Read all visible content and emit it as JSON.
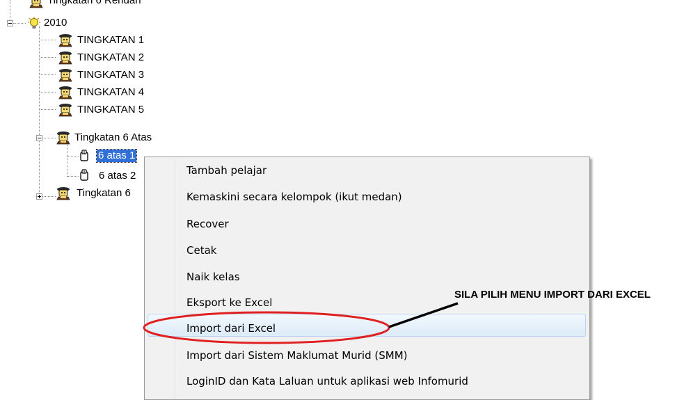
{
  "tree": {
    "top_partial_label": "Tingkatan 6 Rendah",
    "year_node": "2010",
    "items": [
      {
        "label": "TINGKATAN 1"
      },
      {
        "label": "TINGKATAN 2"
      },
      {
        "label": "TINGKATAN 3"
      },
      {
        "label": "TINGKATAN 4"
      },
      {
        "label": "TINGKATAN 5"
      },
      {
        "label": "Tingkatan 6 Atas"
      }
    ],
    "class_items": [
      {
        "label": "6 atas 1",
        "selected": true
      },
      {
        "label": "6 atas 2"
      }
    ],
    "bottom_node": "Tingkatan 6"
  },
  "context_menu": {
    "items": [
      {
        "label": "Tambah pelajar"
      },
      {
        "label": "Kemaskini secara kelompok (ikut medan)"
      },
      {
        "label": "Recover"
      },
      {
        "label": "Cetak"
      },
      {
        "label": "Naik kelas"
      },
      {
        "label": "Eksport ke Excel"
      },
      {
        "label": "Import dari Excel",
        "highlighted": true
      },
      {
        "label": "Import dari Sistem Maklumat Murid (SMM)"
      },
      {
        "label": "LoginID dan Kata Laluan untuk aplikasi web Infomurid"
      }
    ]
  },
  "annotation": {
    "text": "SILA PILIH MENU IMPORT DARI EXCEL",
    "ellipse_color": "#e02020"
  },
  "icons": {
    "year": "lightbulb-icon",
    "level": "student-folder-icon",
    "class": "class-card-icon"
  }
}
